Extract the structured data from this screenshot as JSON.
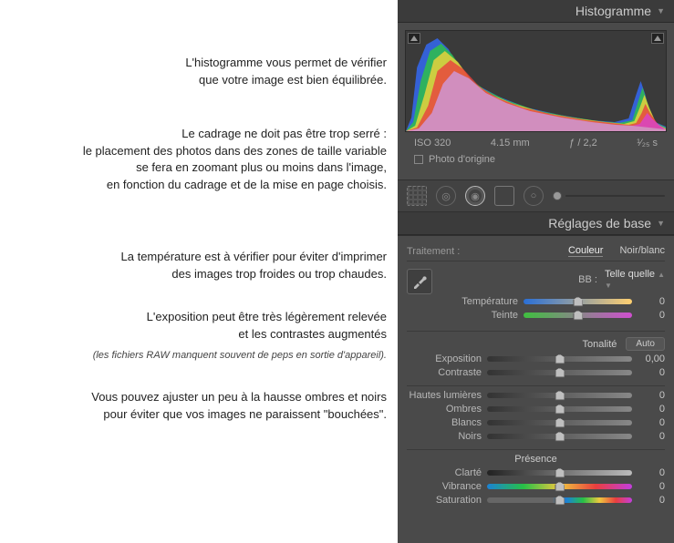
{
  "notes": {
    "n1": "L'histogramme vous permet de vérifier\nque votre image est bien équilibrée.",
    "n2": "Le cadrage ne doit pas être trop serré :\nle placement des photos dans des zones de taille variable\nse fera en zoomant plus ou moins dans l'image,\nen fonction du cadrage et de la mise en page choisis.",
    "n3": "La température est à vérifier pour éviter d'imprimer\ndes images trop froides ou trop chaudes.",
    "n4": "L'exposition peut être très légèrement relevée\net les contrastes augmentés",
    "n4em": "(les fichiers RAW manquent souvent de peps en sortie d'appareil).",
    "n5": "Vous pouvez ajuster un peu à la hausse ombres et noirs\npour éviter que vos images ne paraissent \"bouchées\"."
  },
  "headers": {
    "histogram": "Histogramme",
    "basic": "Réglages de base"
  },
  "exif": {
    "iso": "ISO 320",
    "focal": "4.15 mm",
    "aperture": "ƒ / 2,2",
    "shutter": "¹⁄₂₅ s"
  },
  "origin": {
    "label": "Photo d'origine"
  },
  "treatment": {
    "label": "Traitement :",
    "color": "Couleur",
    "bw": "Noir/blanc"
  },
  "wb": {
    "bb_label": "BB :",
    "preset": "Telle quelle",
    "temp_label": "Température",
    "temp_value": "0",
    "tint_label": "Teinte",
    "tint_value": "0"
  },
  "tone": {
    "title": "Tonalité",
    "auto": "Auto",
    "exposure_label": "Exposition",
    "exposure_value": "0,00",
    "contrast_label": "Contraste",
    "contrast_value": "0",
    "highlights_label": "Hautes lumières",
    "highlights_value": "0",
    "shadows_label": "Ombres",
    "shadows_value": "0",
    "whites_label": "Blancs",
    "whites_value": "0",
    "blacks_label": "Noirs",
    "blacks_value": "0"
  },
  "presence": {
    "title": "Présence",
    "clarity_label": "Clarté",
    "clarity_value": "0",
    "vibrance_label": "Vibrance",
    "vibrance_value": "0",
    "saturation_label": "Saturation",
    "saturation_value": "0"
  }
}
